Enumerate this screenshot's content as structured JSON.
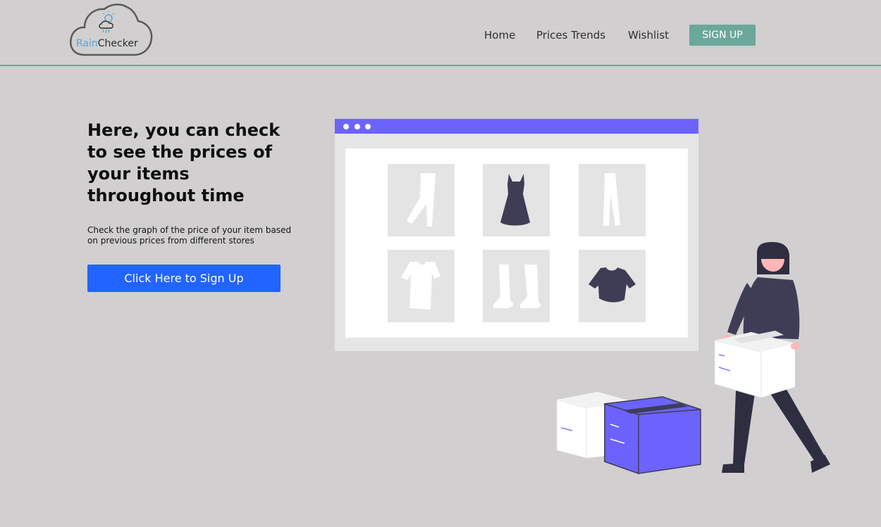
{
  "header": {
    "logo": {
      "rain": "Rain",
      "checker": "Checker"
    },
    "nav": [
      {
        "label": "Home"
      },
      {
        "label": "Prices Trends"
      },
      {
        "label": "Wishlist"
      }
    ],
    "signup_label": "SIGN UP"
  },
  "hero": {
    "title": "Here, you can check to see the prices of your items throughout time",
    "subtitle": "Check the graph of the price of your item based on previous prices from different stores",
    "cta_label": "Click Here to Sign Up"
  },
  "illustration": {
    "window_bar_color": "#6c63ff",
    "items": [
      "pants-icon",
      "dress-icon",
      "trousers-icon",
      "tshirt-icon",
      "boots-icon",
      "crop-top-icon"
    ],
    "accent_color": "#6c63ff",
    "dark_color": "#3f3d56"
  }
}
